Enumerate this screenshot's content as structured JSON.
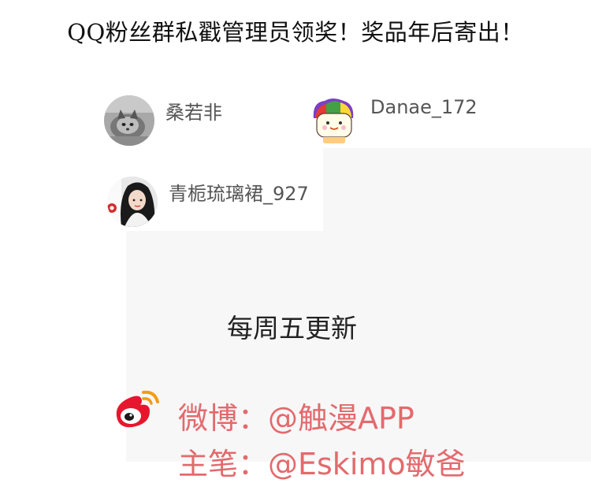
{
  "announcement": "QQ粉丝群私戳管理员领奖！奖品年后寄出！",
  "winners": [
    {
      "name": "桑若非",
      "avatar": "cat-photo-avatar"
    },
    {
      "name": "Danae_172",
      "avatar": "cartoon-character-avatar"
    },
    {
      "name": "青栀琉璃裙_927",
      "avatar": "girl-photo-avatar"
    }
  ],
  "schedule": "每周五更新",
  "social": {
    "weibo_icon": "weibo-logo-icon",
    "weibo_line": "微博：@触漫APP",
    "author_line": "主笔：@Eskimo敏爸"
  },
  "colors": {
    "accent_red": "#e36a6d",
    "panel_gray": "#f7f7f7",
    "text_gray": "#555555"
  }
}
